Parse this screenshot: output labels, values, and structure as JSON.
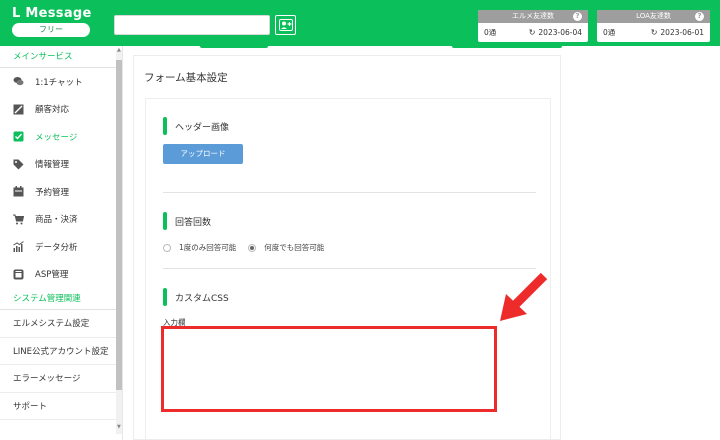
{
  "header": {
    "brand": "L Message",
    "plan": "フリー",
    "stats": [
      {
        "title": "エルメ友達数",
        "count": "0通",
        "date": "2023-06-04",
        "help": "?"
      },
      {
        "title": "LOA友達数",
        "count": "0通",
        "date": "2023-06-01",
        "help": "?"
      }
    ]
  },
  "sidebar": {
    "section_main": "メインサービス",
    "items": [
      {
        "label": "1:1チャット",
        "icon": "chat-icon"
      },
      {
        "label": "顧客対応",
        "icon": "customer-icon"
      },
      {
        "label": "メッセージ",
        "icon": "message-icon",
        "active": true
      },
      {
        "label": "情報管理",
        "icon": "tag-icon"
      },
      {
        "label": "予約管理",
        "icon": "calendar-icon"
      },
      {
        "label": "商品・決済",
        "icon": "cart-icon"
      },
      {
        "label": "データ分析",
        "icon": "chart-icon"
      },
      {
        "label": "ASP管理",
        "icon": "asp-icon"
      }
    ],
    "section_system": "システム管理関連",
    "system_items": [
      {
        "label": "エルメシステム設定"
      },
      {
        "label": "LINE公式アカウント設定"
      },
      {
        "label": "エラーメッセージ"
      },
      {
        "label": "サポート"
      }
    ]
  },
  "main": {
    "title": "フォーム基本設定",
    "header_image": {
      "label": "ヘッダー画像",
      "upload_button": "アップロード"
    },
    "answer_count": {
      "label": "回答回数",
      "options": [
        "1度のみ回答可能",
        "何度でも回答可能"
      ],
      "selected": "何度でも回答可能"
    },
    "custom_css": {
      "label": "カスタムCSS",
      "input_label": "入力欄",
      "value": ""
    }
  },
  "colors": {
    "brand": "#0bbf5a",
    "upload": "#5b9bd8",
    "highlight": "#ee2b2b"
  }
}
